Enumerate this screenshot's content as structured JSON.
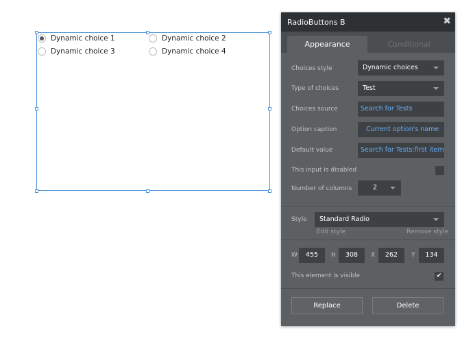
{
  "radio_element": {
    "options": [
      {
        "label": "Dynamic choice 1",
        "checked": true
      },
      {
        "label": "Dynamic choice 2",
        "checked": false
      },
      {
        "label": "Dynamic choice 3",
        "checked": false
      },
      {
        "label": "Dynamic choice 4",
        "checked": false
      }
    ]
  },
  "panel": {
    "title": "RadioButtons B",
    "close_glyph": "✖",
    "tabs": [
      "Appearance",
      "Conditional"
    ],
    "choices_style": {
      "label": "Choices style",
      "value": "Dynamic choices"
    },
    "type_of_choices": {
      "label": "Type of choices",
      "value": "Test"
    },
    "choices_source": {
      "label": "Choices source",
      "value": "Search for Tests"
    },
    "option_caption": {
      "label": "Option caption",
      "value": "Current option's name"
    },
    "default_value": {
      "label": "Default value",
      "value": "Search for Tests:first item"
    },
    "disabled": {
      "label": "This input is disabled",
      "checked": false
    },
    "columns": {
      "label": "Number of columns",
      "value": "2"
    },
    "style": {
      "label": "Style",
      "value": "Standard Radio",
      "edit": "Edit style",
      "remove": "Remove style"
    },
    "geometry": {
      "w_label": "W",
      "w": "455",
      "h_label": "H",
      "h": "308",
      "x_label": "X",
      "x": "262",
      "y_label": "Y",
      "y": "134"
    },
    "visible": {
      "label": "This element is visible",
      "checked": true,
      "check_glyph": "✔"
    },
    "buttons": {
      "replace": "Replace",
      "delete": "Delete"
    }
  },
  "colors": {
    "selection": "#4a90d9",
    "panel_bg": "#5c6063",
    "header_bg": "#2d3134",
    "link": "#6aaef5"
  }
}
